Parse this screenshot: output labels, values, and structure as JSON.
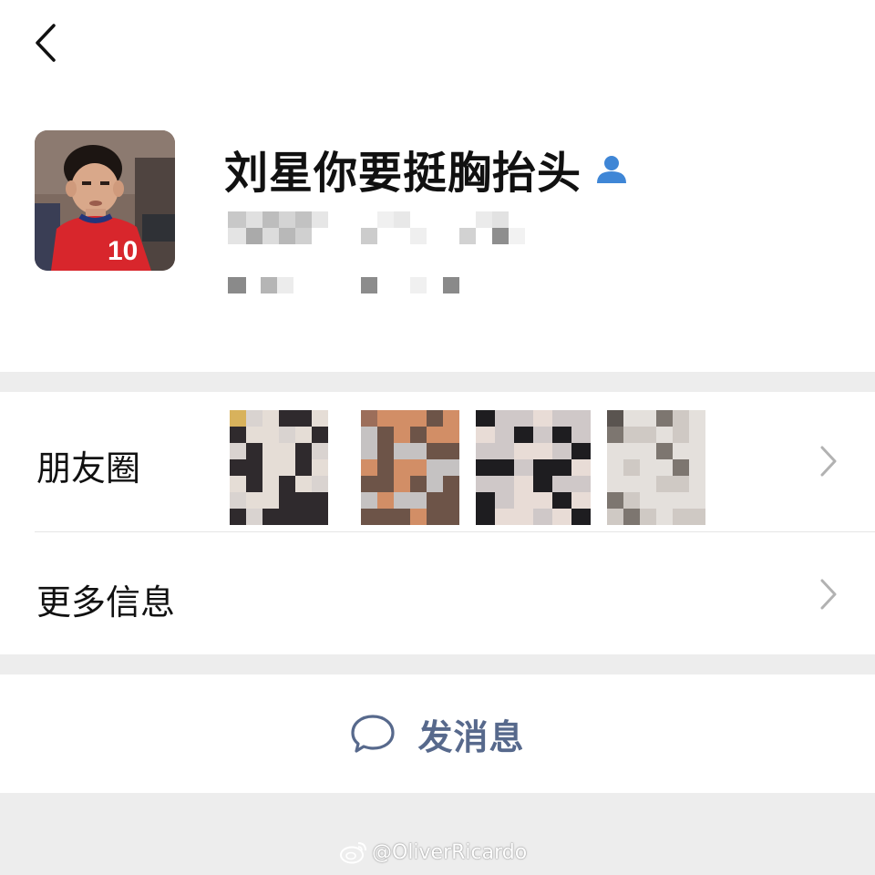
{
  "profile": {
    "nickname": "刘星你要挺胸抬头",
    "icons": {
      "back": "chevron-left-icon",
      "contact": "contact-person-icon"
    },
    "accent_color": "#3f86d6"
  },
  "moments": {
    "label": "朋友圈"
  },
  "more_info": {
    "label": "更多信息"
  },
  "send_message": {
    "label": "发消息",
    "icon": "chat-bubble-icon",
    "color": "#57698c"
  },
  "watermark": {
    "text": "@OliverRicardo",
    "icon": "weibo-icon"
  }
}
